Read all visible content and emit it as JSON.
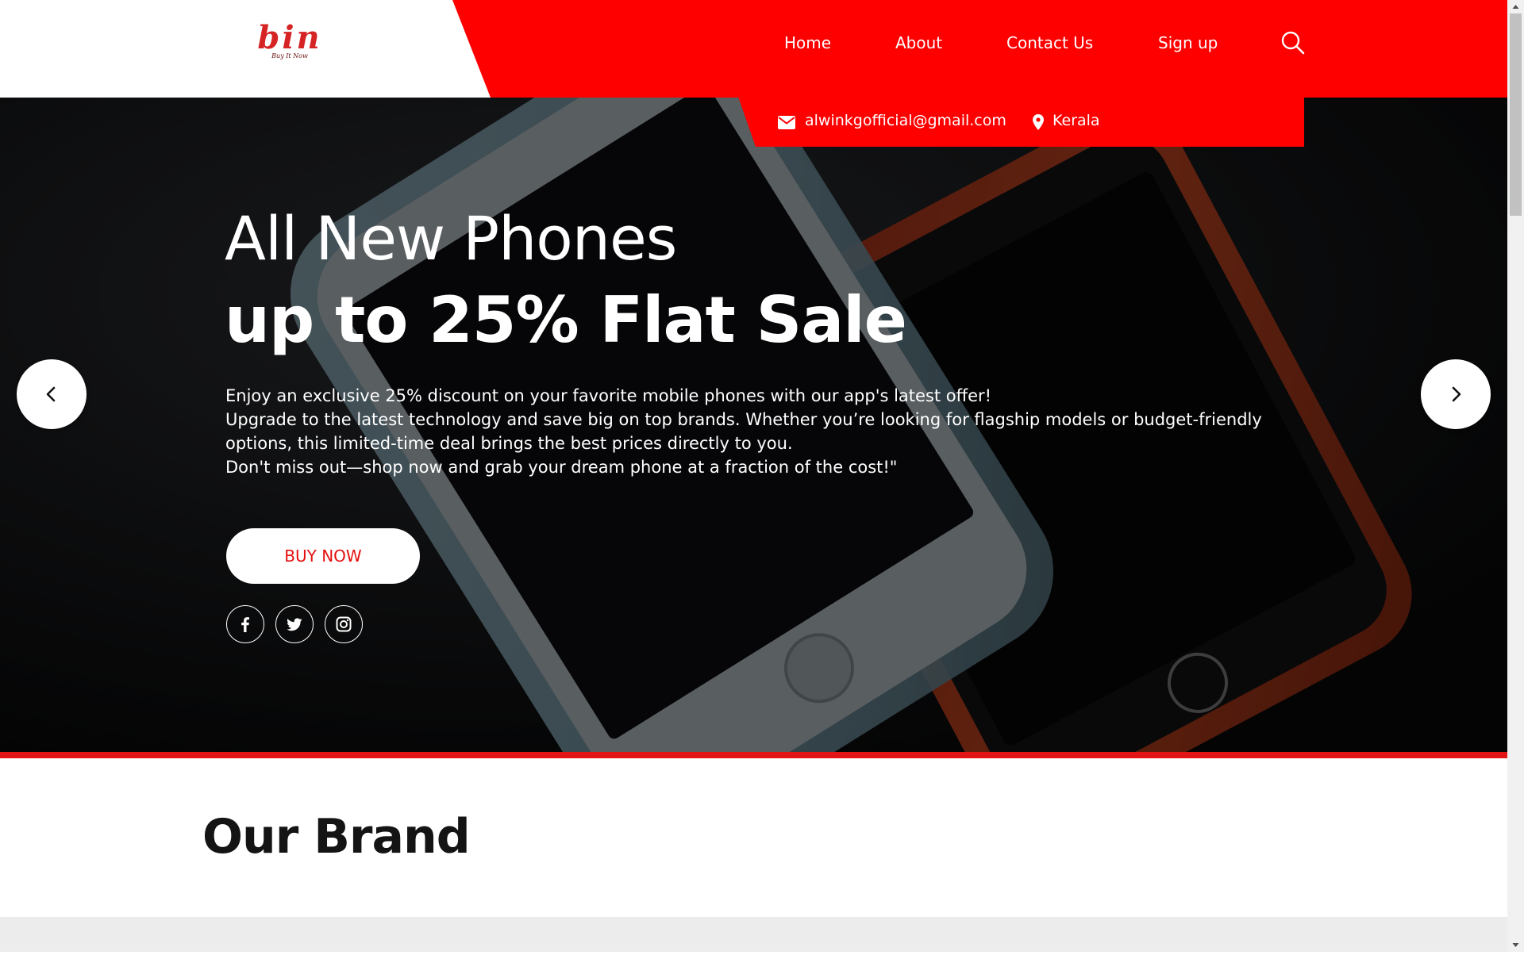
{
  "brand": {
    "logo_text": "bin",
    "logo_tagline": "Buy It Now"
  },
  "nav": {
    "items": [
      {
        "label": "Home"
      },
      {
        "label": "About"
      },
      {
        "label": "Contact Us"
      },
      {
        "label": "Sign up"
      }
    ],
    "search_icon": "search-icon"
  },
  "contact": {
    "email": "alwinkgofficial@gmail.com",
    "location": "Kerala"
  },
  "hero": {
    "title_line1": "All New Phones",
    "title_line2": "up to 25% Flat Sale",
    "description": [
      "Enjoy an exclusive 25% discount on your favorite mobile phones with our app's latest offer!",
      "Upgrade to the latest technology and save big on top brands. Whether you’re looking for flagship models or budget-friendly",
      "options, this limited-time deal brings the best prices directly to you.",
      "Don't miss out—shop now and grab your dream phone at a fraction of the cost!\""
    ],
    "cta_label": "BUY NOW",
    "social_icons": [
      "facebook-icon",
      "twitter-icon",
      "instagram-icon"
    ],
    "prev_icon": "chevron-left-icon",
    "next_icon": "chevron-right-icon"
  },
  "section": {
    "title": "Our Brand"
  },
  "colors": {
    "accent": "#fe0000",
    "cta_text": "#e50f0f",
    "divider": "#e21414",
    "dark": "#141414"
  }
}
